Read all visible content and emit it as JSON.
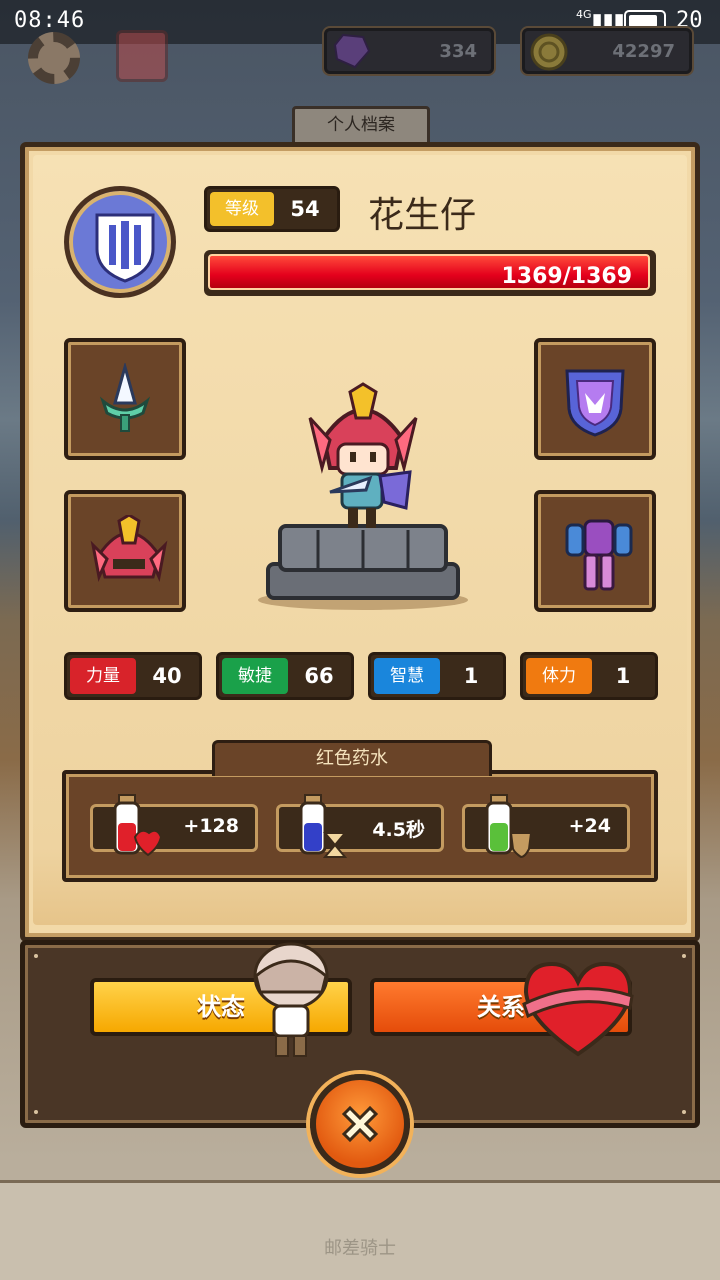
{
  "status_bar": {
    "time": "08:46",
    "network": "4G",
    "battery": "20"
  },
  "resources": {
    "gems": "334",
    "gold": "42297"
  },
  "profile": {
    "tab_title": "个人档案",
    "level_label": "等级",
    "level": "54",
    "name": "花生仔",
    "hp": "1369/1369"
  },
  "equipment": {
    "slots": [
      {
        "icon": "dagger-icon"
      },
      {
        "icon": "helmet-icon"
      },
      {
        "icon": "shield-icon"
      },
      {
        "icon": "armor-icon"
      }
    ]
  },
  "stats": [
    {
      "label": "力量",
      "value": "40",
      "color": "#d8232a"
    },
    {
      "label": "敏捷",
      "value": "66",
      "color": "#1aa14a"
    },
    {
      "label": "智慧",
      "value": "1",
      "color": "#1a86dc"
    },
    {
      "label": "体力",
      "value": "1",
      "color": "#f07a10"
    }
  ],
  "potion": {
    "title": "红色药水",
    "effects": [
      {
        "icon": "red-potion-heart-icon",
        "value": "+128",
        "color": "#e0202a"
      },
      {
        "icon": "blue-potion-hourglass-icon",
        "value": "4.5秒",
        "color": "#3340c8"
      },
      {
        "icon": "green-potion-shield-icon",
        "value": "+24",
        "color": "#5ac03a"
      }
    ]
  },
  "buttons": {
    "status": "状态",
    "relation": "关系"
  },
  "footer": {
    "title": "邮差骑士"
  }
}
